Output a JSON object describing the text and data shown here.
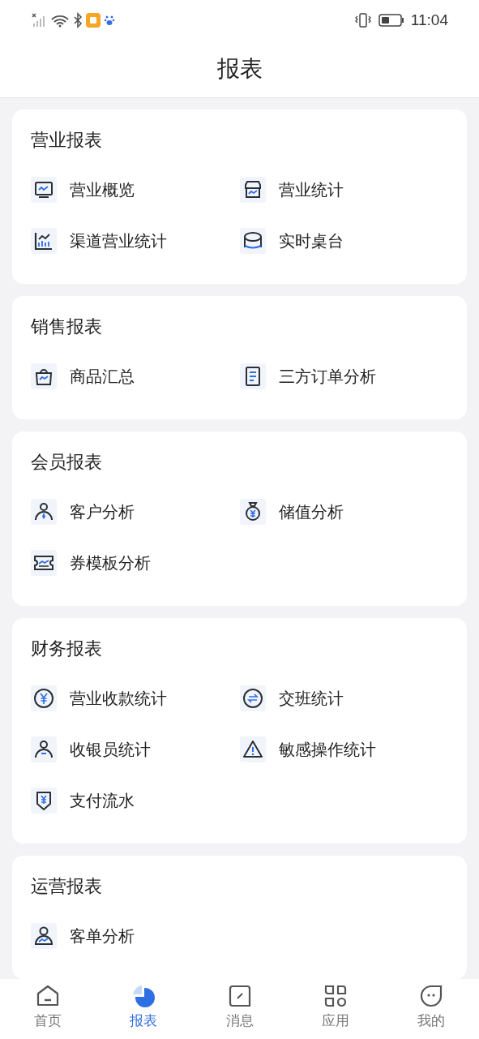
{
  "status_bar": {
    "time": "11:04"
  },
  "header": {
    "title": "报表"
  },
  "sections": [
    {
      "title": "营业报表",
      "items": [
        {
          "label": "营业概览"
        },
        {
          "label": "营业统计"
        },
        {
          "label": "渠道营业统计"
        },
        {
          "label": "实时桌台"
        }
      ]
    },
    {
      "title": "销售报表",
      "items": [
        {
          "label": "商品汇总"
        },
        {
          "label": "三方订单分析"
        }
      ]
    },
    {
      "title": "会员报表",
      "items": [
        {
          "label": "客户分析"
        },
        {
          "label": "储值分析"
        },
        {
          "label": "券模板分析"
        }
      ]
    },
    {
      "title": "财务报表",
      "items": [
        {
          "label": "营业收款统计"
        },
        {
          "label": "交班统计"
        },
        {
          "label": "收银员统计"
        },
        {
          "label": "敏感操作统计"
        },
        {
          "label": "支付流水"
        }
      ]
    },
    {
      "title": "运营报表",
      "items": [
        {
          "label": "客单分析"
        }
      ]
    }
  ],
  "tab_bar": [
    {
      "label": "首页",
      "selected": false
    },
    {
      "label": "报表",
      "selected": true
    },
    {
      "label": "消息",
      "selected": false
    },
    {
      "label": "应用",
      "selected": false
    },
    {
      "label": "我的",
      "selected": false
    }
  ]
}
